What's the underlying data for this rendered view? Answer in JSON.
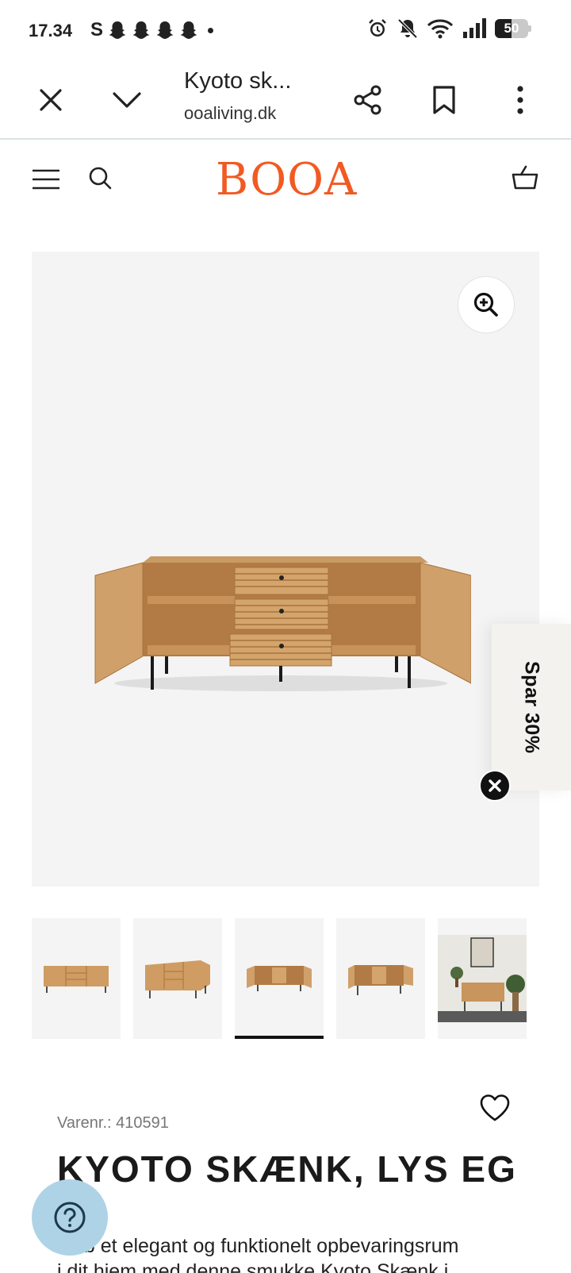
{
  "status_bar": {
    "time": "17.34",
    "left_glyph": "S",
    "battery_level": "50",
    "battery_fraction": 0.5,
    "icons": [
      "snapchat-icon",
      "snapchat-icon",
      "snapchat-icon",
      "snapchat-icon",
      "dot-icon",
      "alarm-icon",
      "mute-icon",
      "wifi-icon",
      "signal-icon",
      "battery-icon"
    ]
  },
  "browser": {
    "title": "Kyoto sk...",
    "url": "ooaliving.dk",
    "icons": [
      "close-icon",
      "chevron-down-icon",
      "share-icon",
      "bookmark-icon",
      "more-icon"
    ]
  },
  "header": {
    "logo": "BOOA",
    "brand_color": "#f15a22",
    "icons": [
      "menu-icon",
      "search-icon",
      "cart-icon"
    ]
  },
  "gallery": {
    "zoom_icon": "zoom-in-icon",
    "active_index": 2,
    "thumbnail_count": 5
  },
  "promo": {
    "label": "Spar 30%",
    "close_icon": "close-icon"
  },
  "product": {
    "sku_label": "Varenr.: 410591",
    "title": "KYOTO SKÆNK, LYS EG",
    "description_line1": "ab et elegant og funktionelt opbevaringsrum",
    "description_line2": "i dit hjem med denne smukke Kyoto Skænk i",
    "wishlist_icon": "heart-icon"
  },
  "help": {
    "icon": "help-icon",
    "color": "#aed3e6"
  }
}
